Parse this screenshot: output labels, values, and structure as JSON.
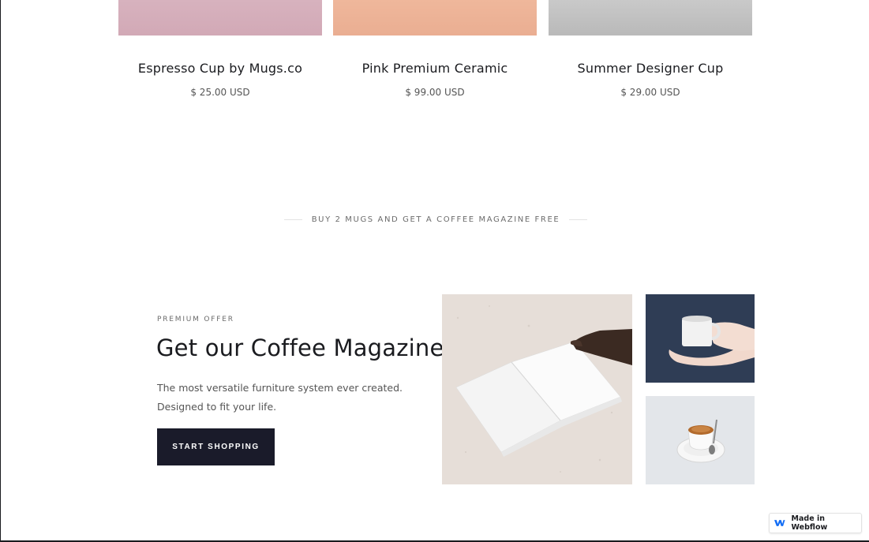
{
  "products": [
    {
      "name": "Espresso Cup by Mugs.co",
      "price": "$ 25.00 USD",
      "color": "#d7b2be"
    },
    {
      "name": "Pink Premium Ceramic",
      "price": "$ 99.00 USD",
      "color": "#efb79b"
    },
    {
      "name": "Summer Designer Cup",
      "price": "$ 29.00 USD",
      "color": "#c9c9c9"
    }
  ],
  "promo_banner": "BUY 2 MUGS AND GET A COFFEE MAGAZINE FREE",
  "offer": {
    "eyebrow": "PREMIUM OFFER",
    "headline": "Get our Coffee Magazine",
    "description_line1": "The most versatile furniture system ever created.",
    "description_line2": "Designed to fit your life.",
    "cta_label": "START SHOPPING"
  },
  "images": {
    "main": "open-magazine-image",
    "top": "hand-holding-mug-image",
    "bottom": "espresso-cup-image"
  },
  "badge": {
    "label": "Made in Webflow",
    "icon": "webflow-logo-icon"
  },
  "colors": {
    "dark": "#1a1b2a",
    "text": "#1a1b1f",
    "muted": "#6b6b6b",
    "webflow_blue": "#146ef5"
  }
}
